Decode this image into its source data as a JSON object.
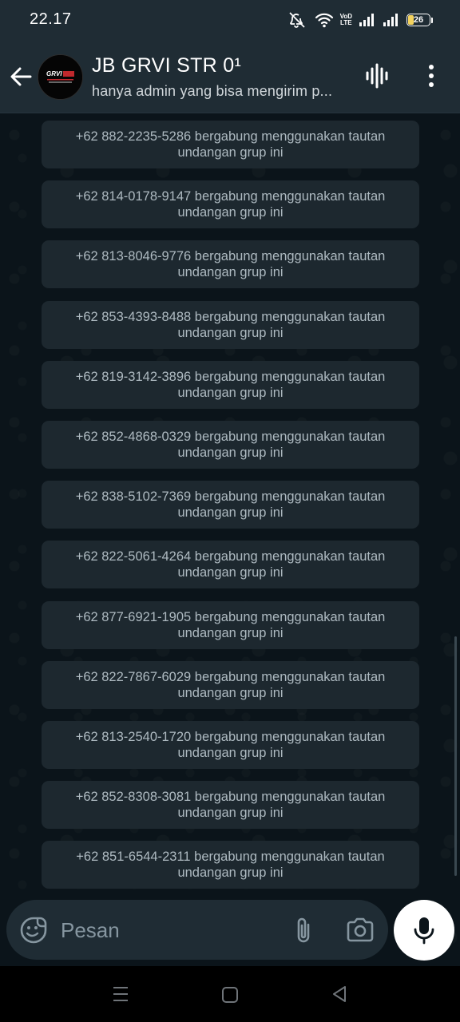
{
  "status_bar": {
    "time": "22.17",
    "volte_top": "VoD",
    "volte_bottom": "LTE",
    "battery_level": "26",
    "icons": [
      "mute-icon",
      "wifi-icon",
      "volte-icon",
      "signal-icon",
      "signal-icon",
      "battery-icon"
    ]
  },
  "header": {
    "title": "JB GRVI STR 0¹",
    "subtitle": "hanya admin yang bisa mengirim p...",
    "icons": [
      "back-arrow-icon",
      "group-avatar",
      "voice-chat-icon",
      "more-vert-icon"
    ]
  },
  "messages": [
    {
      "line1": "+62 882-2235-5286 bergabung menggunakan tautan",
      "line2": "undangan grup ini"
    },
    {
      "line1": "+62 814-0178-9147 bergabung menggunakan tautan",
      "line2": "undangan grup ini"
    },
    {
      "line1": "+62 813-8046-9776 bergabung menggunakan tautan",
      "line2": "undangan grup ini"
    },
    {
      "line1": "+62 853-4393-8488 bergabung menggunakan tautan",
      "line2": "undangan grup ini"
    },
    {
      "line1": "+62 819-3142-3896 bergabung menggunakan tautan",
      "line2": "undangan grup ini"
    },
    {
      "line1": "+62 852-4868-0329 bergabung menggunakan tautan",
      "line2": "undangan grup ini"
    },
    {
      "line1": "+62 838-5102-7369 bergabung menggunakan tautan",
      "line2": "undangan grup ini"
    },
    {
      "line1": "+62 822-5061-4264 bergabung menggunakan tautan",
      "line2": "undangan grup ini"
    },
    {
      "line1": "+62 877-6921-1905 bergabung menggunakan tautan",
      "line2": "undangan grup ini"
    },
    {
      "line1": "+62 822-7867-6029 bergabung menggunakan tautan",
      "line2": "undangan grup ini"
    },
    {
      "line1": "+62 813-2540-1720 bergabung menggunakan tautan",
      "line2": "undangan grup ini"
    },
    {
      "line1": "+62 852-8308-3081 bergabung menggunakan tautan",
      "line2": "undangan grup ini"
    },
    {
      "line1": "+62 851-6544-2311 bergabung menggunakan tautan",
      "line2": "undangan grup ini"
    }
  ],
  "composer": {
    "placeholder": "Pesan",
    "value": "",
    "icons": [
      "emoji-icon",
      "attach-icon",
      "camera-icon",
      "mic-icon"
    ]
  },
  "nav_bar": {
    "icons": [
      "recent-apps-icon",
      "home-icon",
      "back-icon"
    ]
  },
  "colors": {
    "background": "#0b141a",
    "header": "#1f2c34",
    "system_bubble": "#1d282f",
    "system_text": "#aebac1",
    "mic_button": "#ffffff"
  }
}
